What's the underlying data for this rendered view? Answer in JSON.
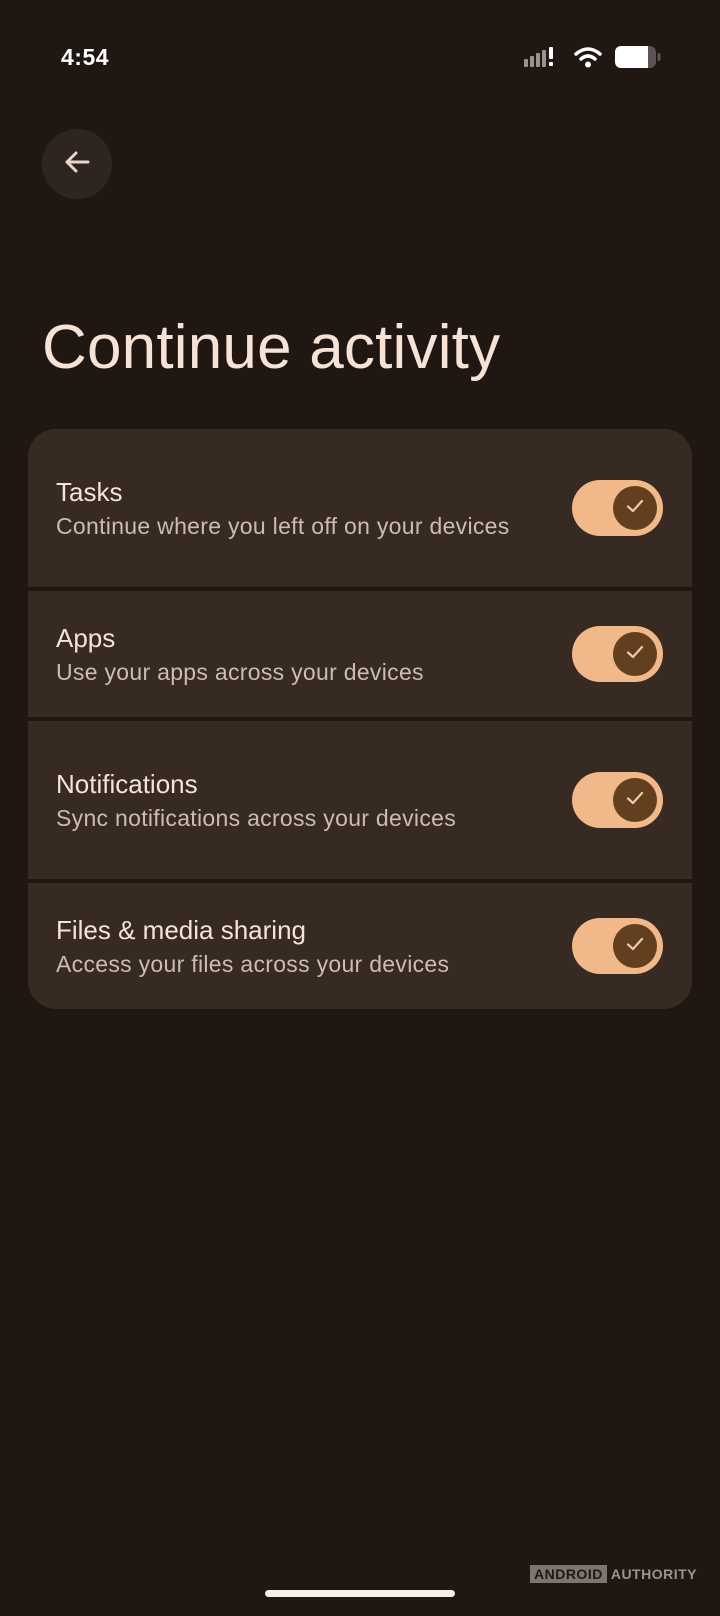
{
  "status_bar": {
    "time": "4:54",
    "icons": [
      "signal-icon",
      "wifi-icon",
      "battery-icon"
    ],
    "battery_level": 0.8
  },
  "header": {
    "back_icon": "arrow-left-icon"
  },
  "page": {
    "title": "Continue activity"
  },
  "settings": [
    {
      "title": "Tasks",
      "description": "Continue where you left off on your devices",
      "enabled": true
    },
    {
      "title": "Apps",
      "description": "Use your apps across your devices",
      "enabled": true
    },
    {
      "title": "Notifications",
      "description": "Sync notifications across your devices",
      "enabled": true
    },
    {
      "title": "Files & media sharing",
      "description": "Access your files across your devices",
      "enabled": true
    }
  ],
  "watermark": {
    "brand_box": "ANDROID",
    "brand_text": "AUTHORITY"
  },
  "colors": {
    "background": "#201713",
    "card": "#362a22",
    "title_text": "#f6e3d5",
    "description_text": "#cdbcaf",
    "toggle_track": "#f1b989",
    "toggle_thumb": "#623f1f"
  }
}
